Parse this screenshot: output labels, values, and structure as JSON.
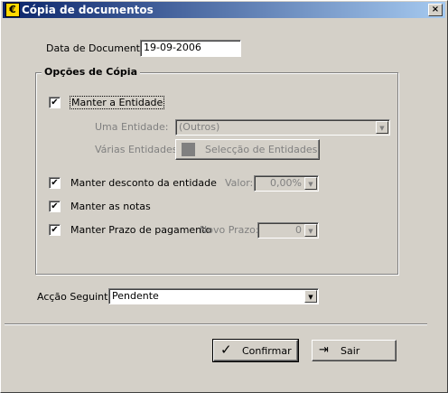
{
  "window": {
    "title": "Cópia de documentos",
    "close_glyph": "×",
    "icon": "euro-icon",
    "icon_glyph": "€"
  },
  "doc_date": {
    "label": "Data de Documento:",
    "value": "19-09-2006"
  },
  "group": {
    "title": "Opções de Cópia"
  },
  "options": {
    "manter_entidade": {
      "label": "Manter a Entidade",
      "checked": true
    },
    "uma_entidade": {
      "label": "Uma Entidade:",
      "value": "(Outros)"
    },
    "varias_entidades": {
      "label": "Várias Entidades:",
      "button": "Selecção de Entidades"
    },
    "manter_desconto": {
      "label": "Manter desconto da entidade",
      "checked": true
    },
    "valor": {
      "label": "Valor:",
      "value": "0,00%"
    },
    "manter_notas": {
      "label": "Manter as notas",
      "checked": true
    },
    "manter_prazo": {
      "label": "Manter Prazo de pagamento",
      "checked": true
    },
    "novo_prazo": {
      "label": "Novo Prazo:",
      "value": "0"
    }
  },
  "next_action": {
    "label": "Acção Seguinte:",
    "value": "Pendente"
  },
  "buttons": {
    "confirm": "Confirmar",
    "exit": "Sair"
  },
  "check_glyph": "✔",
  "arrow_glyph": "▼"
}
